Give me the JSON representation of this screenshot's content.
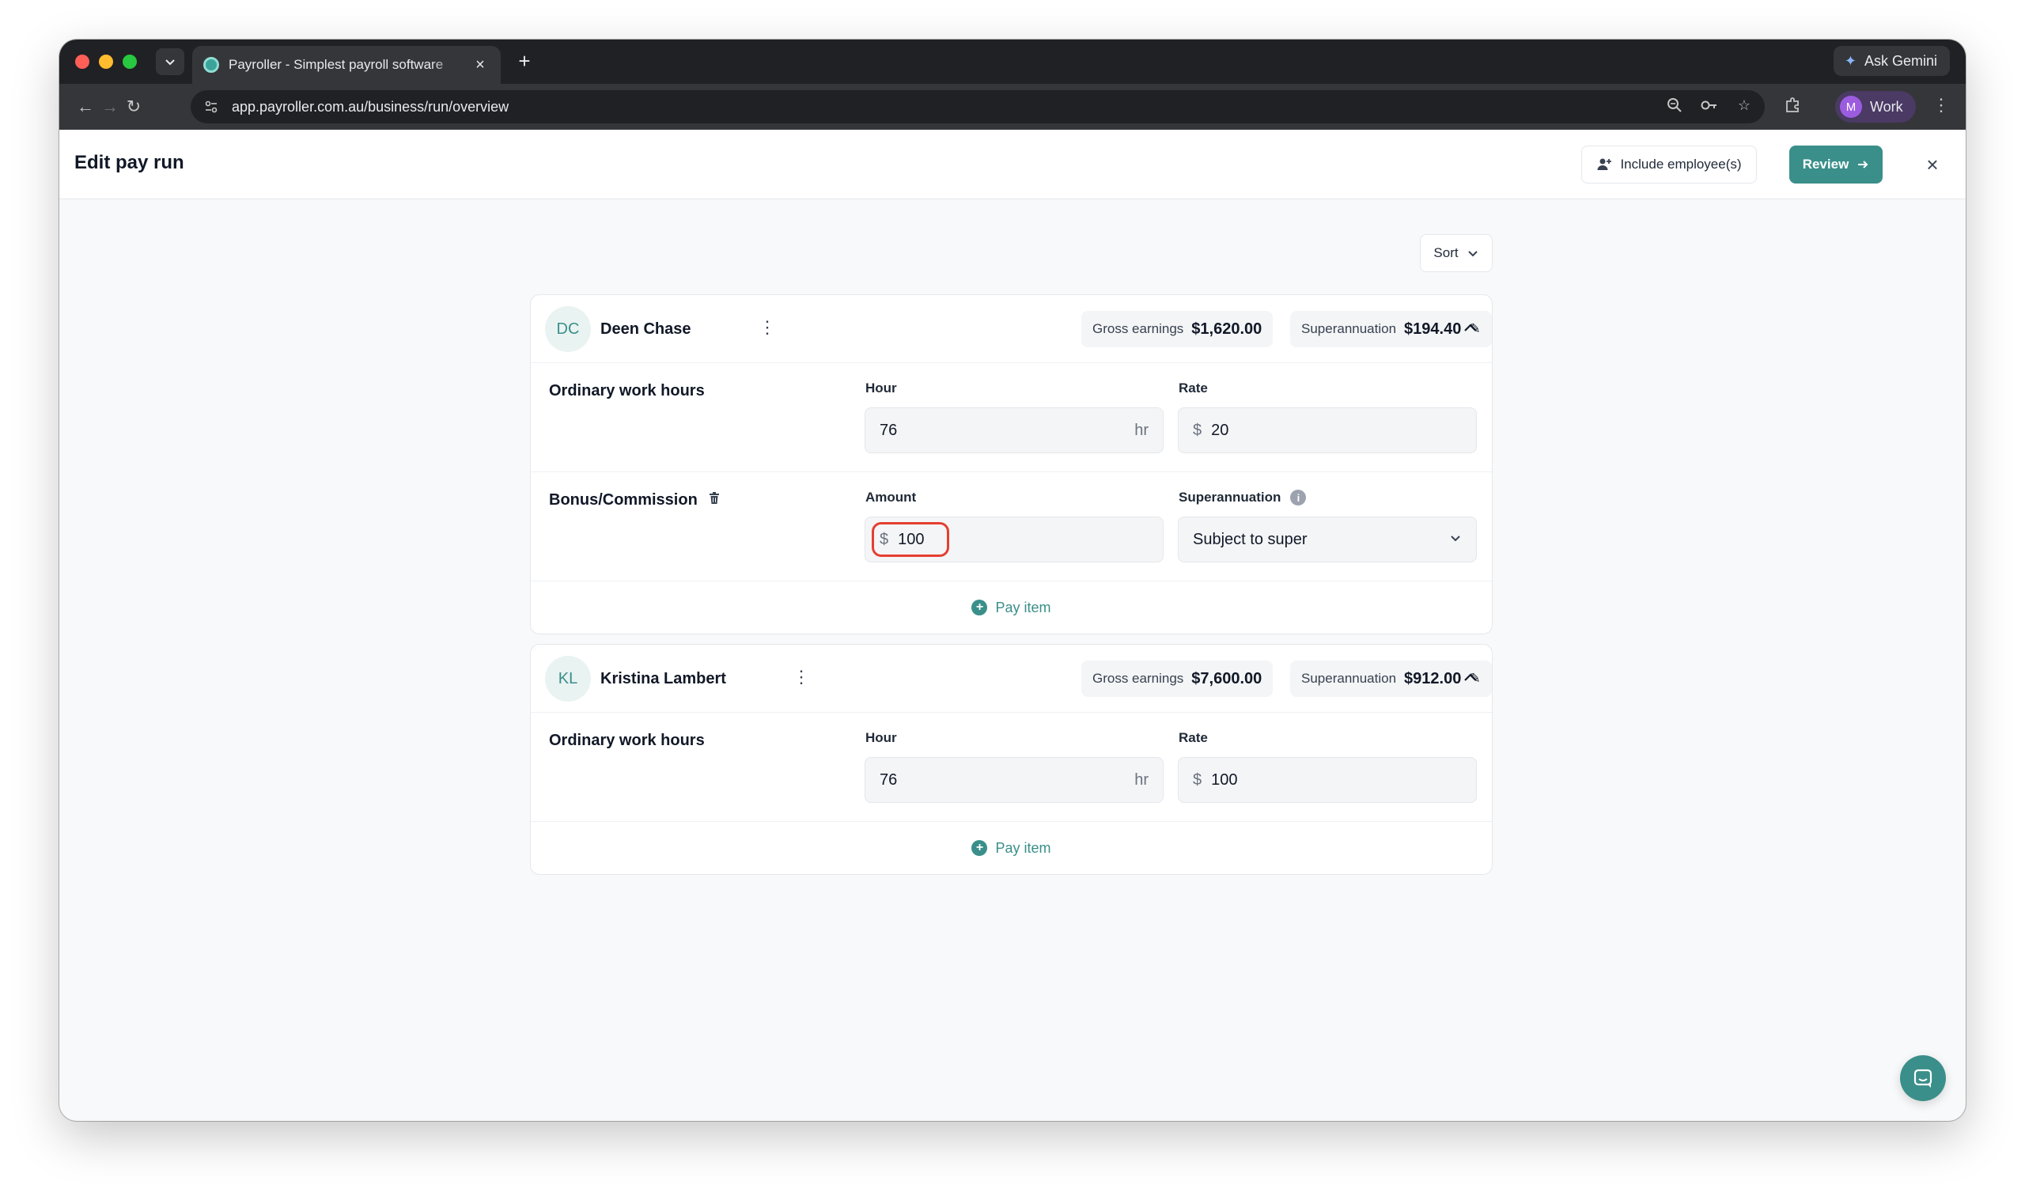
{
  "browser": {
    "tab_title": "Payroller - Simplest payroll software",
    "tab_close": "×",
    "new_tab": "+",
    "url": "app.payroller.com.au/business/run/overview",
    "gemini_label": "Ask Gemini",
    "profile_initial": "M",
    "profile_label": "Work"
  },
  "header": {
    "title": "Edit pay run",
    "include_label": "Include employee(s)",
    "review_label": "Review",
    "close_glyph": "×"
  },
  "sort_label": "Sort",
  "employees": [
    {
      "initials": "DC",
      "name": "Deen Chase",
      "gross_label": "Gross earnings",
      "gross_value": "$1,620.00",
      "super_label": "Superannuation",
      "super_value": "$194.40",
      "ordinary": {
        "label": "Ordinary work hours",
        "hour_label": "Hour",
        "hour_value": "76",
        "hour_unit": "hr",
        "rate_label": "Rate",
        "rate_prefix": "$",
        "rate_value": "20"
      },
      "bonus": {
        "label": "Bonus/Commission",
        "amount_label": "Amount",
        "amount_prefix": "$",
        "amount_value": "100",
        "super_label": "Superannuation",
        "super_option": "Subject to super"
      },
      "add_label": "Pay item"
    },
    {
      "initials": "KL",
      "name": "Kristina Lambert",
      "gross_label": "Gross earnings",
      "gross_value": "$7,600.00",
      "super_label": "Superannuation",
      "super_value": "$912.00",
      "ordinary": {
        "label": "Ordinary work hours",
        "hour_label": "Hour",
        "hour_value": "76",
        "hour_unit": "hr",
        "rate_label": "Rate",
        "rate_prefix": "$",
        "rate_value": "100"
      },
      "add_label": "Pay item"
    }
  ],
  "colors": {
    "accent": "#3a8f8a",
    "highlight": "#e53e2f"
  }
}
